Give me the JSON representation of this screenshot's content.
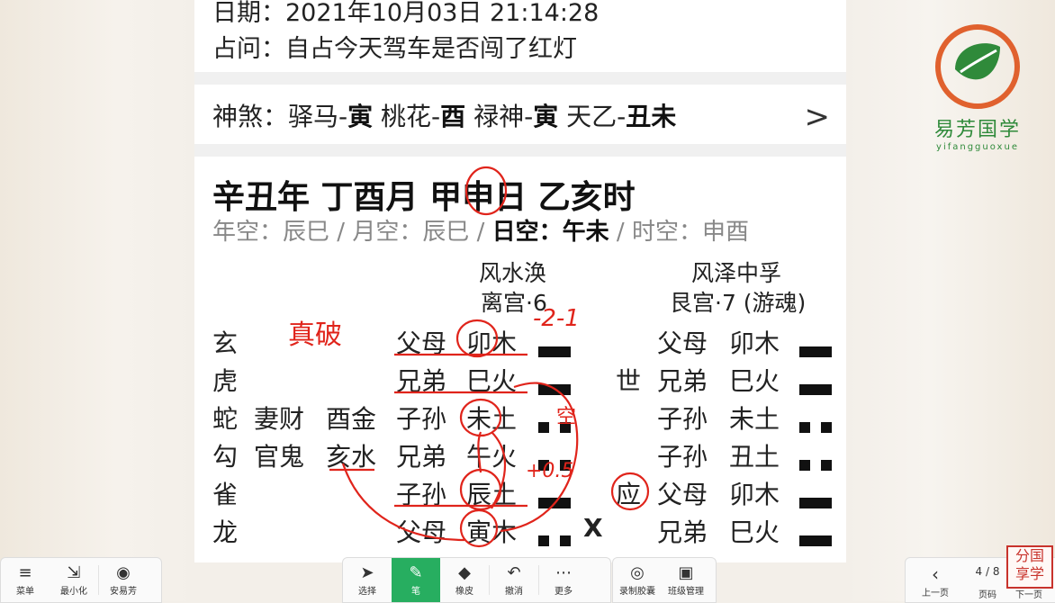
{
  "header": {
    "date": "日期：2021年10月03日 21:14:28",
    "question": "占问：自占今天驾车是否闯了红灯"
  },
  "shensha": {
    "label": "神煞：",
    "items": [
      {
        "name": "驿马-",
        "value": "寅"
      },
      {
        "name": "桃花-",
        "value": "酉"
      },
      {
        "name": "禄神-",
        "value": "寅"
      },
      {
        "name": "天乙-",
        "value": "丑未"
      }
    ],
    "chevron": ">"
  },
  "pillars": "辛丑年 丁酉月 甲申日 乙亥时",
  "kong": {
    "year": "年空：辰巳",
    "sep1": " / ",
    "month": "月空：辰巳",
    "sep2": " / ",
    "day_label": "日空：",
    "day_value": "午未",
    "sep3": " / ",
    "hour": "时空：申酉"
  },
  "main_gua": {
    "name": "风水涣",
    "palace": "离宫·6"
  },
  "changed_gua": {
    "name": "风泽中孚",
    "palace": "艮宫·7 (游魂)"
  },
  "rows": [
    {
      "god": "玄",
      "fu_rel": "",
      "fu_zhi": "",
      "rel": "父母",
      "zhi": "卯木",
      "line": "yang",
      "mark": "",
      "shiying": "",
      "c_rel": "父母",
      "c_zhi": "卯木",
      "c_line": "yang"
    },
    {
      "god": "虎",
      "fu_rel": "",
      "fu_zhi": "",
      "rel": "兄弟",
      "zhi": "巳火",
      "line": "yang",
      "mark": "",
      "shiying": "世",
      "c_rel": "兄弟",
      "c_zhi": "巳火",
      "c_line": "yang"
    },
    {
      "god": "蛇",
      "fu_rel": "妻财",
      "fu_zhi": "酉金",
      "rel": "子孙",
      "zhi": "未土",
      "line": "yin",
      "mark": "",
      "shiying": "",
      "c_rel": "子孙",
      "c_zhi": "未土",
      "c_line": "yin"
    },
    {
      "god": "勾",
      "fu_rel": "官鬼",
      "fu_zhi": "亥水",
      "rel": "兄弟",
      "zhi": "午火",
      "line": "yin",
      "mark": "",
      "shiying": "",
      "c_rel": "子孙",
      "c_zhi": "丑土",
      "c_line": "yin"
    },
    {
      "god": "雀",
      "fu_rel": "",
      "fu_zhi": "",
      "rel": "子孙",
      "zhi": "辰土",
      "line": "yang",
      "mark": "",
      "shiying": "应",
      "c_rel": "父母",
      "c_zhi": "卯木",
      "c_line": "yang"
    },
    {
      "god": "龙",
      "fu_rel": "",
      "fu_zhi": "",
      "rel": "父母",
      "zhi": "寅木",
      "line": "yin",
      "mark": "X",
      "shiying": "",
      "c_rel": "兄弟",
      "c_zhi": "巳火",
      "c_line": "yang"
    }
  ],
  "annotations": {
    "note1": "真破",
    "note2": "-2-1",
    "note3": "空",
    "note4": "+0.5"
  },
  "logo": {
    "name": "易芳国学",
    "sub": "yifangguoxue"
  },
  "stamp": {
    "line1": "分国",
    "line2": "享学"
  },
  "toolbar_left": [
    {
      "icon": "≡",
      "label": "菜单",
      "iconName": "menu-icon"
    },
    {
      "icon": "⇲",
      "label": "最小化",
      "iconName": "minimize-icon"
    },
    {
      "icon": "◉",
      "label": "安易芳",
      "iconName": "app-logo-icon"
    }
  ],
  "toolbar_center": [
    {
      "icon": "➤",
      "label": "选择",
      "iconName": "cursor-icon",
      "active": false
    },
    {
      "icon": "✎",
      "label": "笔",
      "iconName": "pen-icon",
      "active": true
    },
    {
      "icon": "◆",
      "label": "橡皮",
      "iconName": "eraser-icon",
      "active": false
    },
    {
      "icon": "↶",
      "label": "撤消",
      "iconName": "undo-icon",
      "active": false
    },
    {
      "icon": "⋯",
      "label": "更多",
      "iconName": "more-icon",
      "active": false
    }
  ],
  "toolbar_right": [
    {
      "icon": "◎",
      "label": "录制胶囊",
      "iconName": "record-icon"
    },
    {
      "icon": "▣",
      "label": "班级管理",
      "iconName": "class-manage-icon"
    }
  ],
  "pager": {
    "prev_icon": "‹",
    "prev_label": "上一页",
    "page": "4 / 8",
    "page_label": "页码",
    "next_label": "下一页"
  },
  "colors": {
    "accent": "#27ae60",
    "ink": "#e0241b",
    "stamp": "#c8332c"
  }
}
